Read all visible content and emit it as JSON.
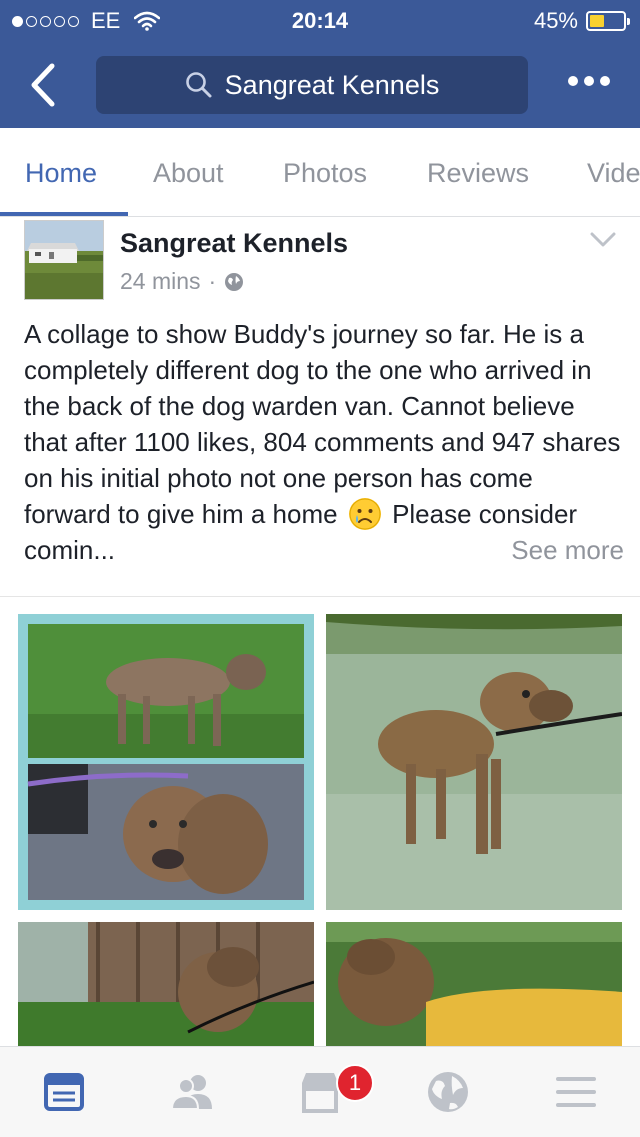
{
  "status_bar": {
    "carrier": "EE",
    "time": "20:14",
    "battery": "45%",
    "battery_level": 0.45,
    "signal_bars": 1
  },
  "nav": {
    "search_text": "Sangreat Kennels"
  },
  "tabs": [
    {
      "label": "Home",
      "active": true
    },
    {
      "label": "About"
    },
    {
      "label": "Photos"
    },
    {
      "label": "Reviews"
    },
    {
      "label": "Vide"
    }
  ],
  "post": {
    "author": "Sangreat Kennels",
    "time": "24 mins",
    "separator": "·",
    "text_part1": "A collage to show Buddy's journey so far. He is a completely different dog to the one who arrived in the back of the dog warden van. Cannot believe that after 1100 likes, 804 comments and 947 shares on his initial photo not one person has come forward to give him a home",
    "text_part2": "Please consider comin...",
    "see_more": "See more"
  },
  "bottom_bar": {
    "notification_count": "1"
  },
  "colors": {
    "brand": "#3b5998",
    "tab_active": "#4267b2",
    "badge": "#e0242f"
  }
}
